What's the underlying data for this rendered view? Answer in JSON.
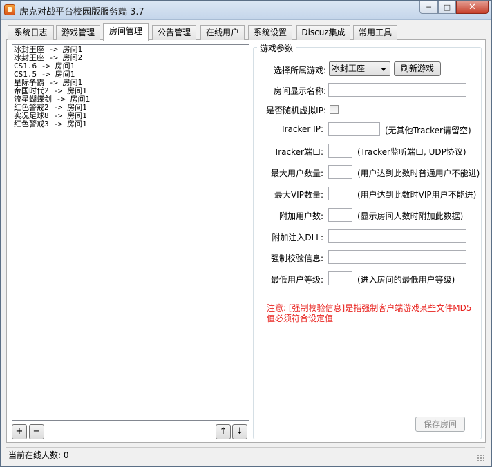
{
  "window": {
    "title": "虎克对战平台校园版服务端 3.7",
    "min_symbol": "─",
    "max_symbol": "□",
    "close_symbol": "✕"
  },
  "tabs": [
    "系统日志",
    "游戏管理",
    "房间管理",
    "公告管理",
    "在线用户",
    "系统设置",
    "Discuz集成",
    "常用工具"
  ],
  "active_tab": "房间管理",
  "room_list": [
    "冰封王座 -> 房间1",
    "冰封王座 -> 房间2",
    "CS1.6 -> 房间1",
    "CS1.5 -> 房间1",
    "星际争霸 -> 房间1",
    "帝国时代2 -> 房间1",
    "流星蝴蝶剑 -> 房间1",
    "红色警戒2 -> 房间1",
    "实况足球8 -> 房间1",
    "红色警戒3 -> 房间1"
  ],
  "list_buttons": {
    "add": "+",
    "remove": "−",
    "up": "↑",
    "down": "↓"
  },
  "params": {
    "group_title": "游戏参数",
    "game_label": "选择所属游戏:",
    "game_selected": "冰封王座",
    "refresh_button": "刷新游戏",
    "room_name_label": "房间显示名称:",
    "room_name_value": "",
    "virtual_ip_label": "是否随机虚拟IP:",
    "tracker_ip_label": "Tracker IP:",
    "tracker_ip_value": "",
    "tracker_ip_hint": "(无其他Tracker请留空)",
    "tracker_port_label": "Tracker端口:",
    "tracker_port_value": "",
    "tracker_port_hint": "(Tracker监听端口, UDP协议)",
    "max_users_label": "最大用户数量:",
    "max_users_value": "",
    "max_users_hint": "(用户达到此数时普通用户不能进)",
    "max_vip_label": "最大VIP数量:",
    "max_vip_value": "",
    "max_vip_hint": "(用户达到此数时VIP用户不能进)",
    "extra_users_label": "附加用户数:",
    "extra_users_value": "",
    "extra_users_hint": "(显示房间人数时附加此数据)",
    "dll_label": "附加注入DLL:",
    "dll_value": "",
    "verify_label": "强制校验信息:",
    "verify_value": "",
    "min_level_label": "最低用户等级:",
    "min_level_value": "",
    "min_level_hint": "(进入房间的最低用户等级)",
    "note": "注意: [强制校验信息]是指强制客户端游戏某些文件MD5值必须符合设定值",
    "save_button": "保存房间"
  },
  "status": {
    "online_label": "当前在线人数: 0"
  },
  "colors": {
    "note": "#e8231f",
    "title_bar": "#c4d5ea"
  }
}
